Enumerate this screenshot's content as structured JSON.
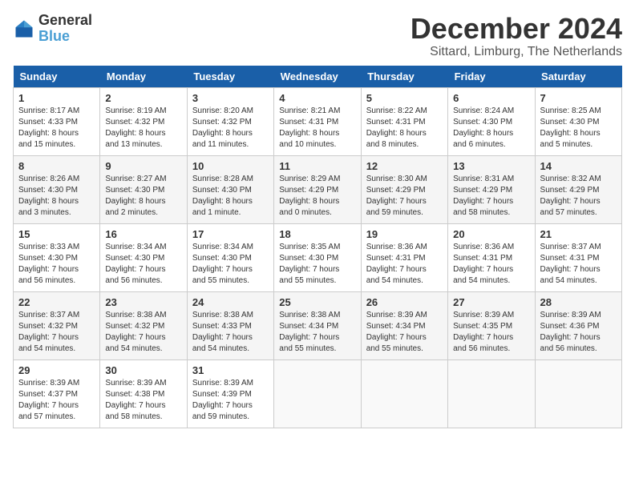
{
  "logo": {
    "line1": "General",
    "line2": "Blue"
  },
  "title": "December 2024",
  "subtitle": "Sittard, Limburg, The Netherlands",
  "days_of_week": [
    "Sunday",
    "Monday",
    "Tuesday",
    "Wednesday",
    "Thursday",
    "Friday",
    "Saturday"
  ],
  "weeks": [
    [
      {
        "day": "1",
        "info": "Sunrise: 8:17 AM\nSunset: 4:33 PM\nDaylight: 8 hours\nand 15 minutes."
      },
      {
        "day": "2",
        "info": "Sunrise: 8:19 AM\nSunset: 4:32 PM\nDaylight: 8 hours\nand 13 minutes."
      },
      {
        "day": "3",
        "info": "Sunrise: 8:20 AM\nSunset: 4:32 PM\nDaylight: 8 hours\nand 11 minutes."
      },
      {
        "day": "4",
        "info": "Sunrise: 8:21 AM\nSunset: 4:31 PM\nDaylight: 8 hours\nand 10 minutes."
      },
      {
        "day": "5",
        "info": "Sunrise: 8:22 AM\nSunset: 4:31 PM\nDaylight: 8 hours\nand 8 minutes."
      },
      {
        "day": "6",
        "info": "Sunrise: 8:24 AM\nSunset: 4:30 PM\nDaylight: 8 hours\nand 6 minutes."
      },
      {
        "day": "7",
        "info": "Sunrise: 8:25 AM\nSunset: 4:30 PM\nDaylight: 8 hours\nand 5 minutes."
      }
    ],
    [
      {
        "day": "8",
        "info": "Sunrise: 8:26 AM\nSunset: 4:30 PM\nDaylight: 8 hours\nand 3 minutes."
      },
      {
        "day": "9",
        "info": "Sunrise: 8:27 AM\nSunset: 4:30 PM\nDaylight: 8 hours\nand 2 minutes."
      },
      {
        "day": "10",
        "info": "Sunrise: 8:28 AM\nSunset: 4:30 PM\nDaylight: 8 hours\nand 1 minute."
      },
      {
        "day": "11",
        "info": "Sunrise: 8:29 AM\nSunset: 4:29 PM\nDaylight: 8 hours\nand 0 minutes."
      },
      {
        "day": "12",
        "info": "Sunrise: 8:30 AM\nSunset: 4:29 PM\nDaylight: 7 hours\nand 59 minutes."
      },
      {
        "day": "13",
        "info": "Sunrise: 8:31 AM\nSunset: 4:29 PM\nDaylight: 7 hours\nand 58 minutes."
      },
      {
        "day": "14",
        "info": "Sunrise: 8:32 AM\nSunset: 4:29 PM\nDaylight: 7 hours\nand 57 minutes."
      }
    ],
    [
      {
        "day": "15",
        "info": "Sunrise: 8:33 AM\nSunset: 4:30 PM\nDaylight: 7 hours\nand 56 minutes."
      },
      {
        "day": "16",
        "info": "Sunrise: 8:34 AM\nSunset: 4:30 PM\nDaylight: 7 hours\nand 56 minutes."
      },
      {
        "day": "17",
        "info": "Sunrise: 8:34 AM\nSunset: 4:30 PM\nDaylight: 7 hours\nand 55 minutes."
      },
      {
        "day": "18",
        "info": "Sunrise: 8:35 AM\nSunset: 4:30 PM\nDaylight: 7 hours\nand 55 minutes."
      },
      {
        "day": "19",
        "info": "Sunrise: 8:36 AM\nSunset: 4:31 PM\nDaylight: 7 hours\nand 54 minutes."
      },
      {
        "day": "20",
        "info": "Sunrise: 8:36 AM\nSunset: 4:31 PM\nDaylight: 7 hours\nand 54 minutes."
      },
      {
        "day": "21",
        "info": "Sunrise: 8:37 AM\nSunset: 4:31 PM\nDaylight: 7 hours\nand 54 minutes."
      }
    ],
    [
      {
        "day": "22",
        "info": "Sunrise: 8:37 AM\nSunset: 4:32 PM\nDaylight: 7 hours\nand 54 minutes."
      },
      {
        "day": "23",
        "info": "Sunrise: 8:38 AM\nSunset: 4:32 PM\nDaylight: 7 hours\nand 54 minutes."
      },
      {
        "day": "24",
        "info": "Sunrise: 8:38 AM\nSunset: 4:33 PM\nDaylight: 7 hours\nand 54 minutes."
      },
      {
        "day": "25",
        "info": "Sunrise: 8:38 AM\nSunset: 4:34 PM\nDaylight: 7 hours\nand 55 minutes."
      },
      {
        "day": "26",
        "info": "Sunrise: 8:39 AM\nSunset: 4:34 PM\nDaylight: 7 hours\nand 55 minutes."
      },
      {
        "day": "27",
        "info": "Sunrise: 8:39 AM\nSunset: 4:35 PM\nDaylight: 7 hours\nand 56 minutes."
      },
      {
        "day": "28",
        "info": "Sunrise: 8:39 AM\nSunset: 4:36 PM\nDaylight: 7 hours\nand 56 minutes."
      }
    ],
    [
      {
        "day": "29",
        "info": "Sunrise: 8:39 AM\nSunset: 4:37 PM\nDaylight: 7 hours\nand 57 minutes."
      },
      {
        "day": "30",
        "info": "Sunrise: 8:39 AM\nSunset: 4:38 PM\nDaylight: 7 hours\nand 58 minutes."
      },
      {
        "day": "31",
        "info": "Sunrise: 8:39 AM\nSunset: 4:39 PM\nDaylight: 7 hours\nand 59 minutes."
      },
      {
        "day": "",
        "info": ""
      },
      {
        "day": "",
        "info": ""
      },
      {
        "day": "",
        "info": ""
      },
      {
        "day": "",
        "info": ""
      }
    ]
  ]
}
